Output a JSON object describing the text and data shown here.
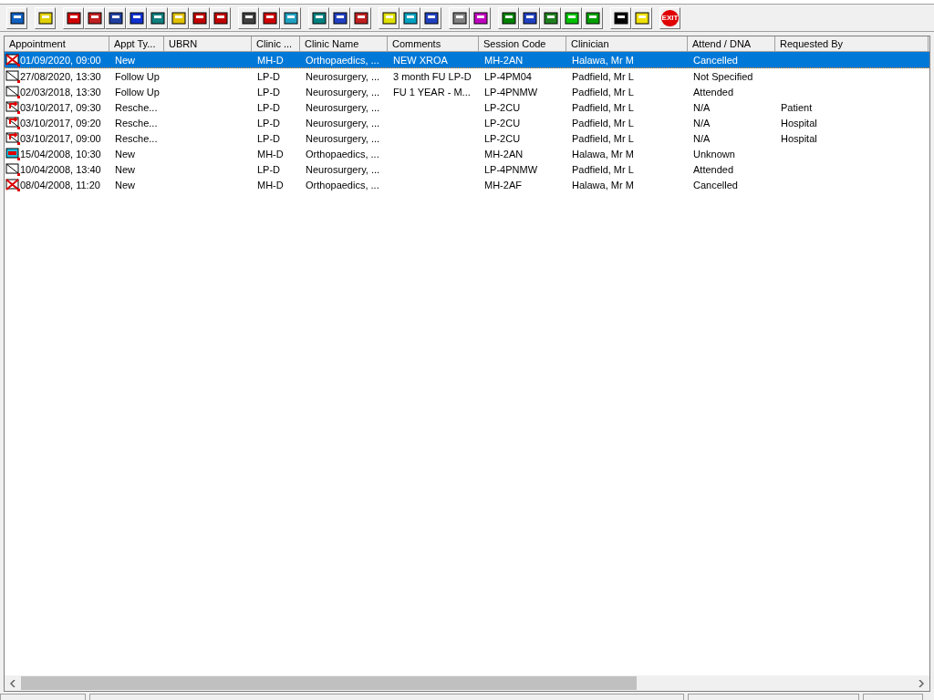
{
  "toolbar": {
    "exit_label": "EXIT"
  },
  "table": {
    "columns": [
      "Appointment",
      "Appt Ty...",
      "UBRN",
      "Clinic ...",
      "Clinic Name",
      "Comments",
      "Session Code",
      "Clinician",
      "Attend / DNA",
      "Requested By"
    ],
    "rows": [
      {
        "kind": "cancelled",
        "selected": true,
        "cells": [
          "01/09/2020, 09:00",
          "New",
          "",
          "MH-D",
          "Orthopaedics, ...",
          "NEW XROA",
          "MH-2AN",
          "Halawa, Mr M",
          "Cancelled",
          ""
        ]
      },
      {
        "kind": "letter",
        "selected": false,
        "cells": [
          "27/08/2020, 13:30",
          "Follow Up",
          "",
          "LP-D",
          "Neurosurgery, ...",
          "3 month FU LP-D",
          "LP-4PM04",
          "Padfield, Mr L",
          "Not Specified",
          ""
        ]
      },
      {
        "kind": "letter",
        "selected": false,
        "cells": [
          "02/03/2018, 13:30",
          "Follow Up",
          "",
          "LP-D",
          "Neurosurgery, ...",
          "FU 1 YEAR - M...",
          "LP-4PNMW",
          "Padfield, Mr L",
          "Attended",
          ""
        ]
      },
      {
        "kind": "rescheduled",
        "selected": false,
        "cells": [
          "03/10/2017, 09:30",
          "Resche...",
          "",
          "LP-D",
          "Neurosurgery, ...",
          "",
          "LP-2CU",
          "Padfield, Mr L",
          "N/A",
          "Patient"
        ]
      },
      {
        "kind": "rescheduled",
        "selected": false,
        "cells": [
          "03/10/2017, 09:20",
          "Resche...",
          "",
          "LP-D",
          "Neurosurgery, ...",
          "",
          "LP-2CU",
          "Padfield, Mr L",
          "N/A",
          "Hospital"
        ]
      },
      {
        "kind": "rescheduled",
        "selected": false,
        "cells": [
          "03/10/2017, 09:00",
          "Resche...",
          "",
          "LP-D",
          "Neurosurgery, ...",
          "",
          "LP-2CU",
          "Padfield, Mr L",
          "N/A",
          "Hospital"
        ]
      },
      {
        "kind": "dna",
        "selected": false,
        "cells": [
          "15/04/2008, 10:30",
          "New",
          "",
          "MH-D",
          "Orthopaedics, ...",
          "",
          "MH-2AN",
          "Halawa, Mr M",
          "Unknown",
          ""
        ]
      },
      {
        "kind": "letter",
        "selected": false,
        "cells": [
          "10/04/2008, 13:40",
          "New",
          "",
          "LP-D",
          "Neurosurgery, ...",
          "",
          "LP-4PNMW",
          "Padfield, Mr L",
          "Attended",
          ""
        ]
      },
      {
        "kind": "cancelled",
        "selected": false,
        "cells": [
          "08/04/2008, 11:20",
          "New",
          "",
          "MH-D",
          "Orthopaedics, ...",
          "",
          "MH-2AF",
          "Halawa, Mr M",
          "Cancelled",
          ""
        ]
      }
    ]
  }
}
